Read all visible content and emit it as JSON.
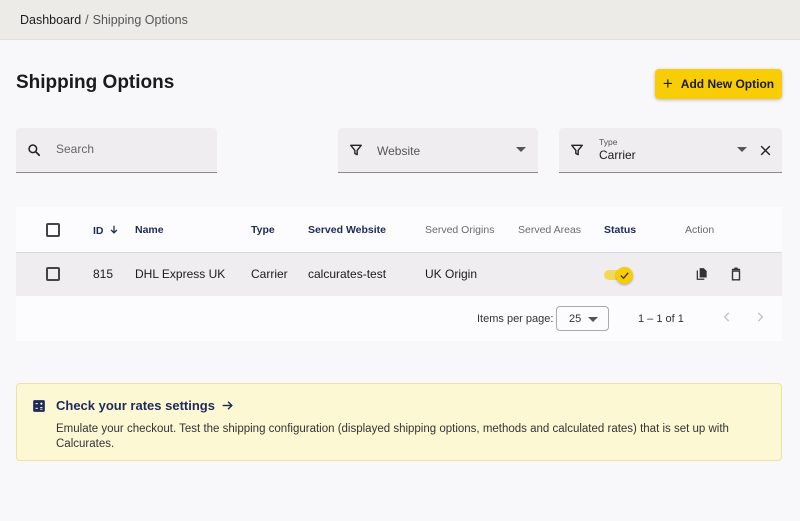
{
  "breadcrumb": {
    "root": "Dashboard",
    "separator": "/",
    "current": "Shipping Options"
  },
  "page": {
    "title": "Shipping Options",
    "add_button_label": "Add New Option"
  },
  "filters": {
    "search_placeholder": "Search",
    "website_placeholder": "Website",
    "type_label": "Type",
    "type_value": "Carrier"
  },
  "table": {
    "columns": {
      "id": "ID",
      "name": "Name",
      "type": "Type",
      "served_website": "Served Website",
      "served_origins": "Served Origins",
      "served_areas": "Served Areas",
      "status": "Status",
      "action": "Action"
    },
    "rows": [
      {
        "id": "815",
        "name": "DHL Express UK",
        "type": "Carrier",
        "served_website": "calcurates-test",
        "served_origins": "UK Origin",
        "served_areas": "",
        "status_enabled": true
      }
    ]
  },
  "pagination": {
    "items_per_page_label": "Items per page:",
    "items_per_page_value": "25",
    "range": "1 – 1 of 1"
  },
  "banner": {
    "title": "Check your rates settings",
    "text": "Emulate your checkout. Test the shipping configuration (displayed shipping options, methods and calculated rates) that is set up with Calcurates."
  },
  "colors": {
    "accent": "#f8cd06",
    "header_text": "#1e2a5a",
    "banner_bg": "#fdf8d4"
  },
  "icons": {
    "search": "search-icon",
    "filter": "filter-icon",
    "sort": "arrow-down-icon",
    "copy": "copy-icon",
    "delete": "delete-icon",
    "calculator": "calculator-icon"
  }
}
